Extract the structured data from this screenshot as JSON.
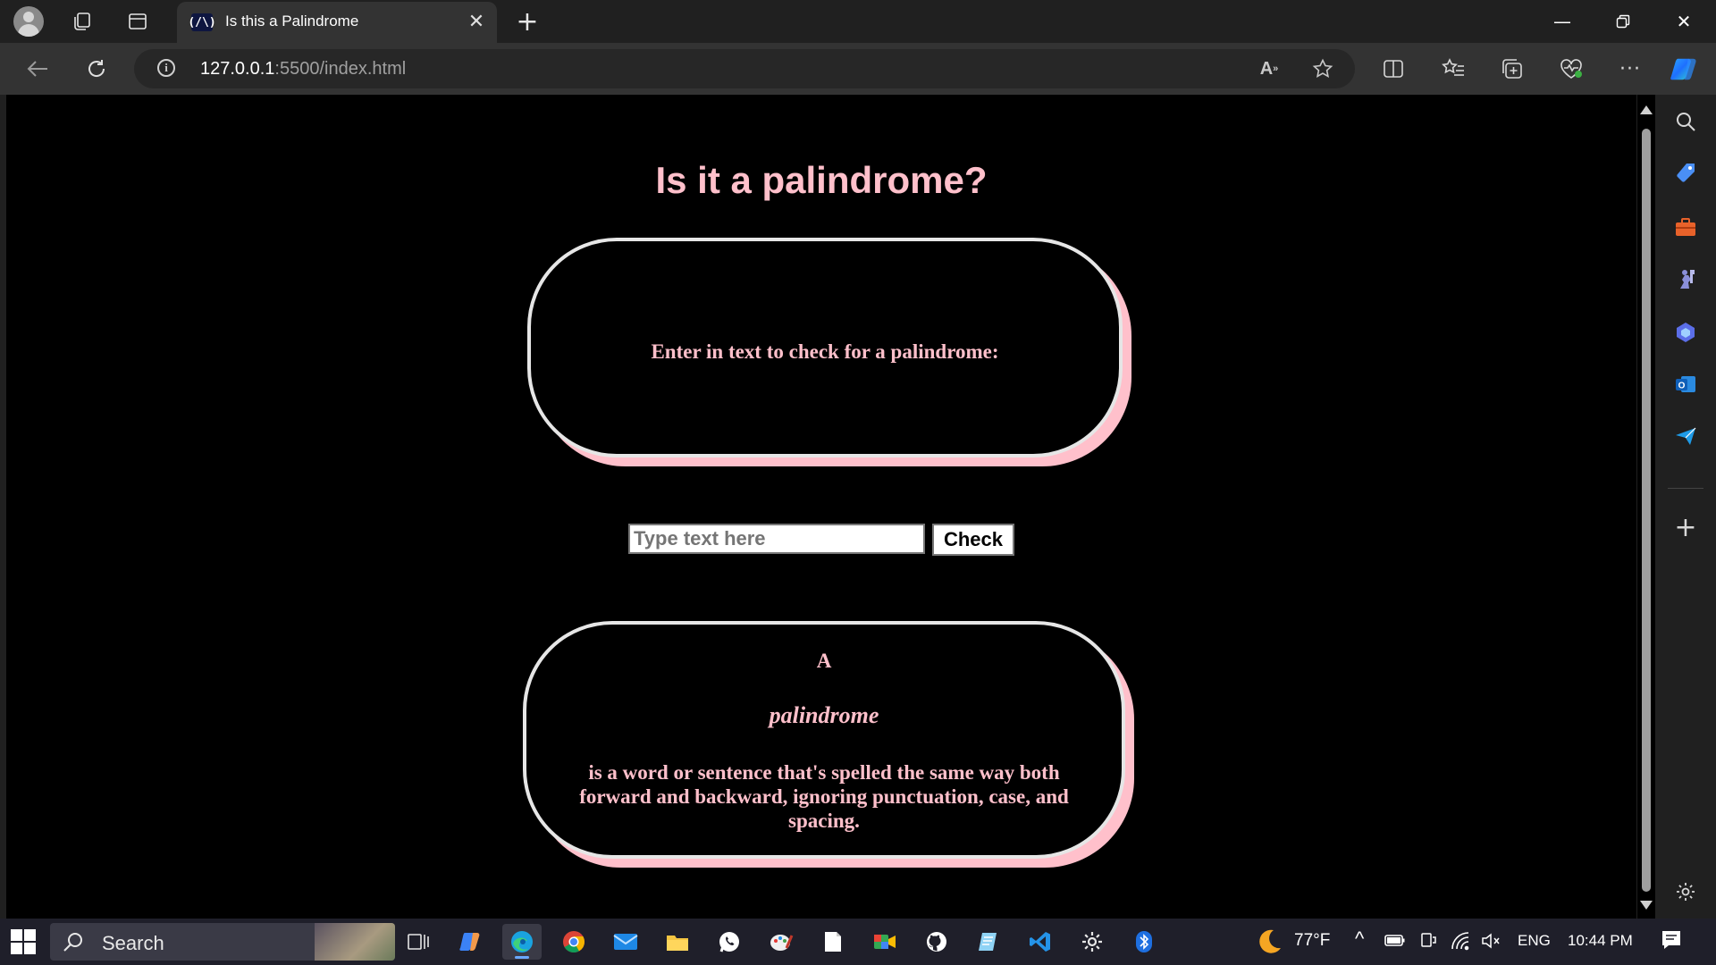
{
  "browser": {
    "tab": {
      "favicon_text": "(/\\)",
      "title": "Is this a Palindrome"
    },
    "address": {
      "host": "127.0.0.1",
      "rest": ":5500/index.html"
    }
  },
  "page": {
    "title": "Is it a palindrome?",
    "prompt": "Enter in text to check for a palindrome:",
    "input_placeholder": "Type text here",
    "check_button": "Check",
    "definition": {
      "lead": "A",
      "word": "palindrome",
      "text": "is a word or sentence that's spelled the same way both forward and backward, ignoring punctuation, case, and spacing."
    }
  },
  "colors": {
    "accent": "#ffc0cb",
    "page_bg": "#000000"
  },
  "taskbar": {
    "search_label": "Search",
    "weather": "77°F",
    "language": "ENG",
    "time": "10:44 PM"
  }
}
